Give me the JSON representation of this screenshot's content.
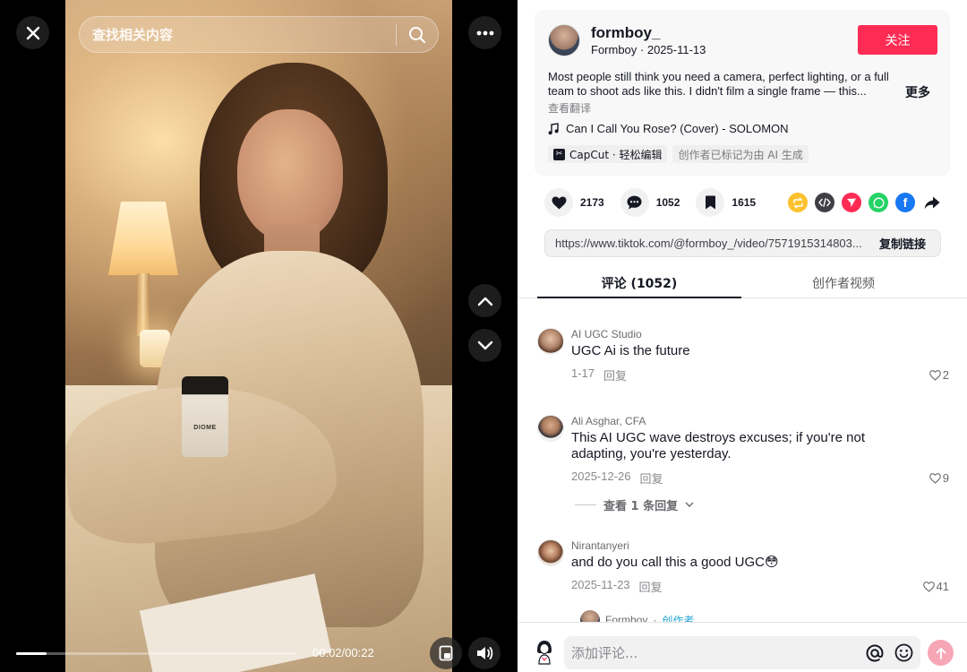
{
  "search": {
    "placeholder": "查找相关内容"
  },
  "video": {
    "jar_label": "DIOME",
    "time": "00:02/00:22",
    "progress_fraction": 0.11
  },
  "author": {
    "name": "formboy_",
    "sub": "Formboy · 2025-11-13",
    "follow_label": "关注"
  },
  "description": {
    "text": "Most people still think you need a camera, perfect lighting, or a full team to shoot ads like this. I didn't film a single frame — this...",
    "more": "更多",
    "translate": "查看翻译"
  },
  "music": {
    "title": "Can I Call You Rose? (Cover) - SOLOMON"
  },
  "tags": {
    "capcut": "CapCut · 轻松编辑",
    "ai": "创作者已标记为由 AI 生成"
  },
  "actions": {
    "likes": "2173",
    "comments": "1052",
    "saves": "1615"
  },
  "link": {
    "url": "https://www.tiktok.com/@formboy_/video/7571915314803...",
    "copy_label": "复制链接"
  },
  "tabs": {
    "comments": "评论 (1052)",
    "videos": "创作者视频"
  },
  "comments": [
    {
      "user": "AI UGC Studio",
      "text": "UGC Ai is the future",
      "date": "1-17",
      "reply": "回复",
      "likes": "2"
    },
    {
      "user": "Ali Asghar, CFA",
      "text": "This AI UGC wave destroys excuses; if you're not adapting, you're yesterday.",
      "date": "2025-12-26",
      "reply": "回复",
      "likes": "9"
    },
    {
      "user": "Nirantanyeri",
      "text": "and do you call this a good UGC😳",
      "date": "2025-11-23",
      "reply": "回复",
      "likes": "41"
    }
  ],
  "view_replies": "查看 1 条回复",
  "reply_preview": {
    "user": "Formboy",
    "creator": "创作者"
  },
  "comment_box": {
    "placeholder": "添加评论..."
  },
  "colors": {
    "accent": "#fe2c55",
    "send_disabled": "#f7a6b6",
    "creator": "#20a3d6"
  },
  "share_icons": [
    "repost-icon",
    "embed-icon",
    "send-to-friends-icon",
    "whatsapp-icon",
    "facebook-icon",
    "share-arrow-icon"
  ]
}
